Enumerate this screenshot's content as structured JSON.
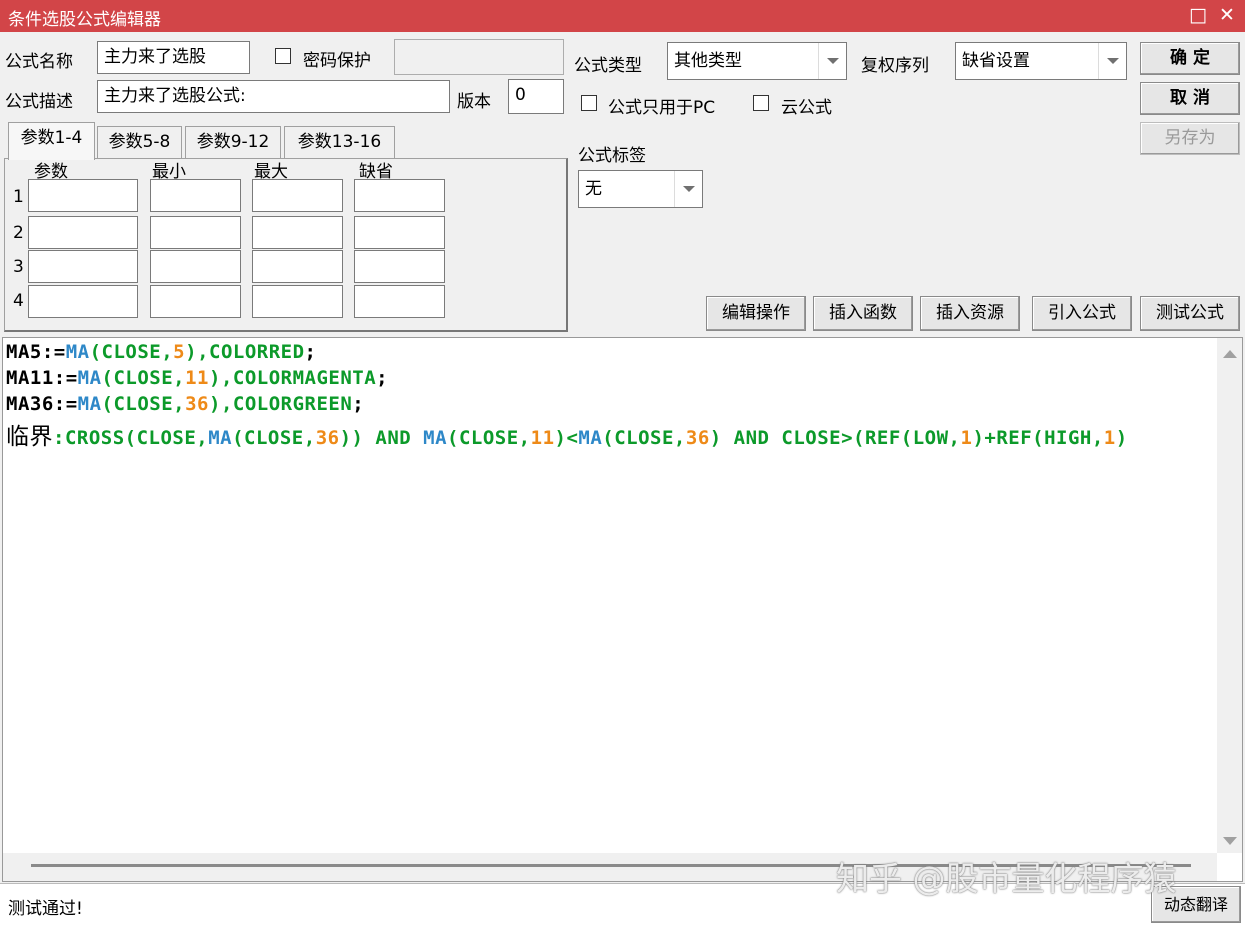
{
  "window": {
    "title": "条件选股公式编辑器",
    "maximize_glyph": "□",
    "close_glyph": "✕"
  },
  "form": {
    "name_label": "公式名称",
    "name_value": "主力来了选股",
    "password_label": "密码保护",
    "desc_label": "公式描述",
    "desc_value": "主力来了选股公式:",
    "version_label": "版本",
    "version_value": "0",
    "type_label": "公式类型",
    "type_value": "其他类型",
    "rights_label": "复权序列",
    "rights_value": "缺省设置",
    "pc_only_label": "公式只用于PC",
    "cloud_label": "云公式",
    "tag_label": "公式标签",
    "tag_value": "无"
  },
  "buttons": {
    "ok": "确  定",
    "cancel": "取  消",
    "save_as": "另存为",
    "edit_ops": "编辑操作",
    "insert_func": "插入函数",
    "insert_res": "插入资源",
    "import_formula": "引入公式",
    "test_formula": "测试公式",
    "dynamic_translate": "动态翻译"
  },
  "tabs": [
    "参数1-4",
    "参数5-8",
    "参数9-12",
    "参数13-16"
  ],
  "params": {
    "headers": [
      "参数",
      "最小",
      "最大",
      "缺省"
    ],
    "rows": [
      "1",
      "2",
      "3",
      "4"
    ]
  },
  "code": {
    "l1": [
      "MA5:=",
      "MA",
      "(CLOSE,",
      "5",
      "),",
      "COLORRED",
      ";"
    ],
    "l2": [
      "MA11:=",
      "MA",
      "(CLOSE,",
      "11",
      "),",
      "COLORMAGENTA",
      ";"
    ],
    "l3": [
      "MA36:=",
      "MA",
      "(CLOSE,",
      "36",
      "),",
      "COLORGREEN",
      ";"
    ],
    "l4": [
      "临界",
      ":CROSS(CLOSE,",
      "MA",
      "(CLOSE,",
      "36",
      ")) AND ",
      "MA",
      "(CLOSE,",
      "11",
      ")<",
      "MA",
      "(CLOSE,",
      "36",
      ") AND CLOSE>(REF(LOW,",
      "1",
      ")+REF(HIGH,",
      "1",
      ")"
    ]
  },
  "status": {
    "text": "测试通过!"
  },
  "watermark": "知乎 @股市量化程序猿"
}
